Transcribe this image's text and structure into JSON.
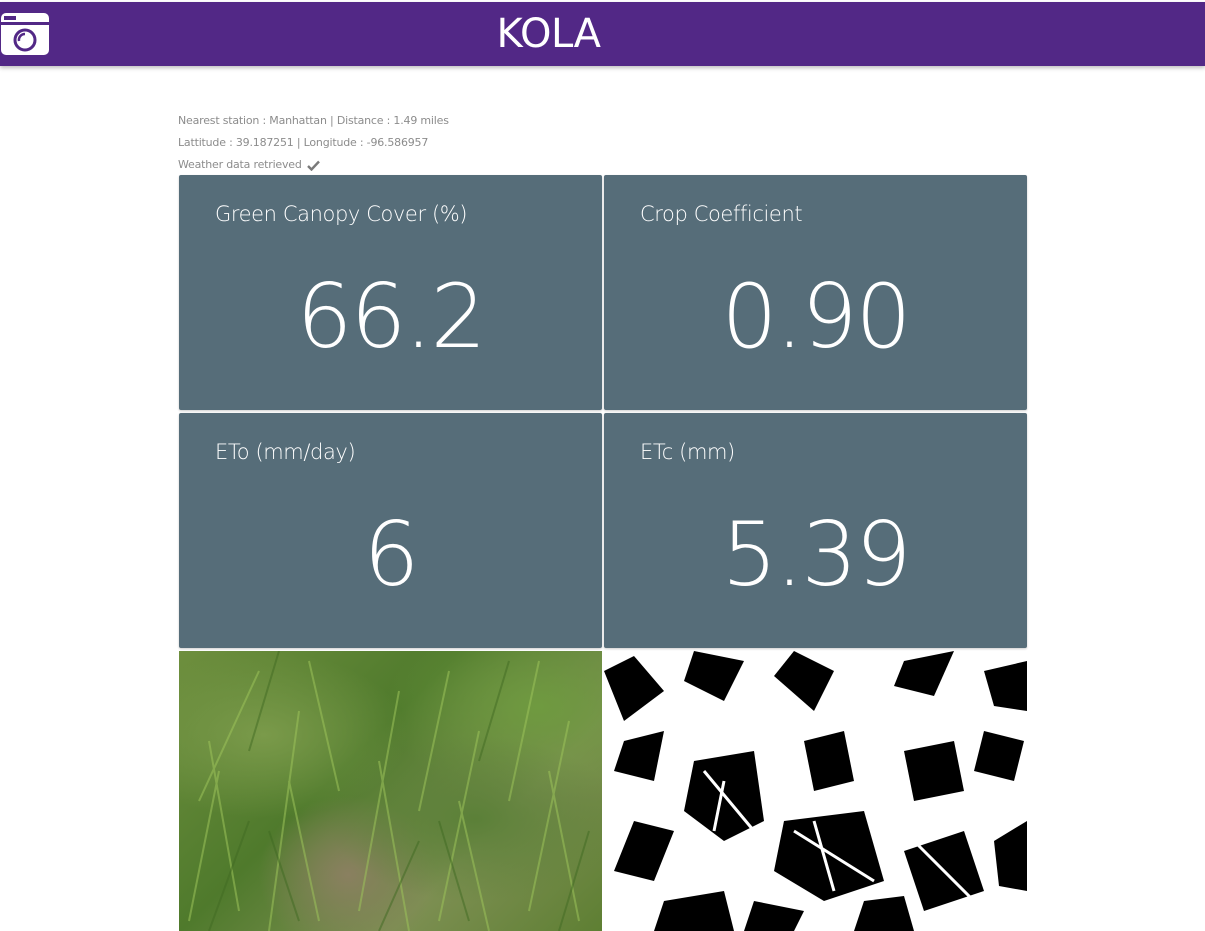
{
  "header": {
    "title": "KOLA",
    "camera_icon": "camera-icon",
    "color": "#522886"
  },
  "station": {
    "line1": "Nearest station : Manhattan | Distance : 1.49 miles",
    "line2": "Lattitude : 39.187251 | Longitude : -96.586957",
    "line3": "Weather data retrieved",
    "check_icon": "check-icon"
  },
  "cards": [
    {
      "label": "Green Canopy Cover (%)",
      "value": "66.2"
    },
    {
      "label": "Crop Coefficient",
      "value": "0.90"
    },
    {
      "label": "ETo (mm/day)",
      "value": "6"
    },
    {
      "label": "ETc (mm)",
      "value": "5.39"
    }
  ],
  "card_color": "#566d79",
  "images": {
    "photo": "grass-photo",
    "mask": "canopy-mask-image"
  }
}
